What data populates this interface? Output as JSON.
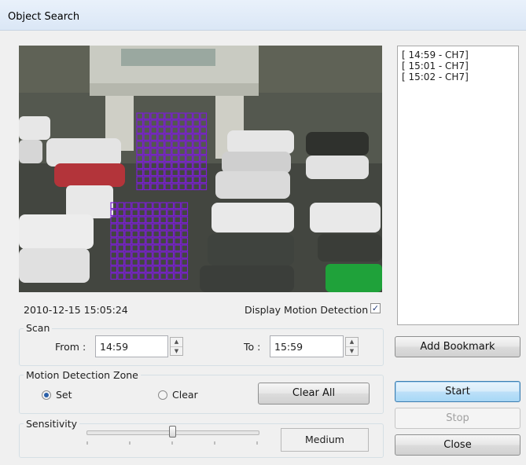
{
  "window": {
    "title": "Object Search"
  },
  "video": {
    "timestamp": "2010-12-15  15:05:24"
  },
  "display_motion": {
    "label": "Display Motion Detection",
    "checked": true
  },
  "bookmarks": [
    "[ 14:59 - CH7]",
    "[ 15:01 - CH7]",
    "[ 15:02 - CH7]"
  ],
  "scan": {
    "title": "Scan",
    "from_label": "From :",
    "from_value": "14:59",
    "to_label": "To :",
    "to_value": "15:59"
  },
  "motion_zone": {
    "title": "Motion Detection Zone",
    "set_label": "Set",
    "clear_label": "Clear",
    "clear_all_label": "Clear All",
    "selected": "Set"
  },
  "sensitivity": {
    "title": "Sensitivity",
    "value_label": "Medium",
    "level": 0.5
  },
  "buttons": {
    "add_bookmark": "Add Bookmark",
    "start": "Start",
    "stop": "Stop",
    "close": "Close"
  },
  "colors": {
    "zone_grid": "#7b1fd2",
    "focus_border": "#3c7fb1"
  }
}
